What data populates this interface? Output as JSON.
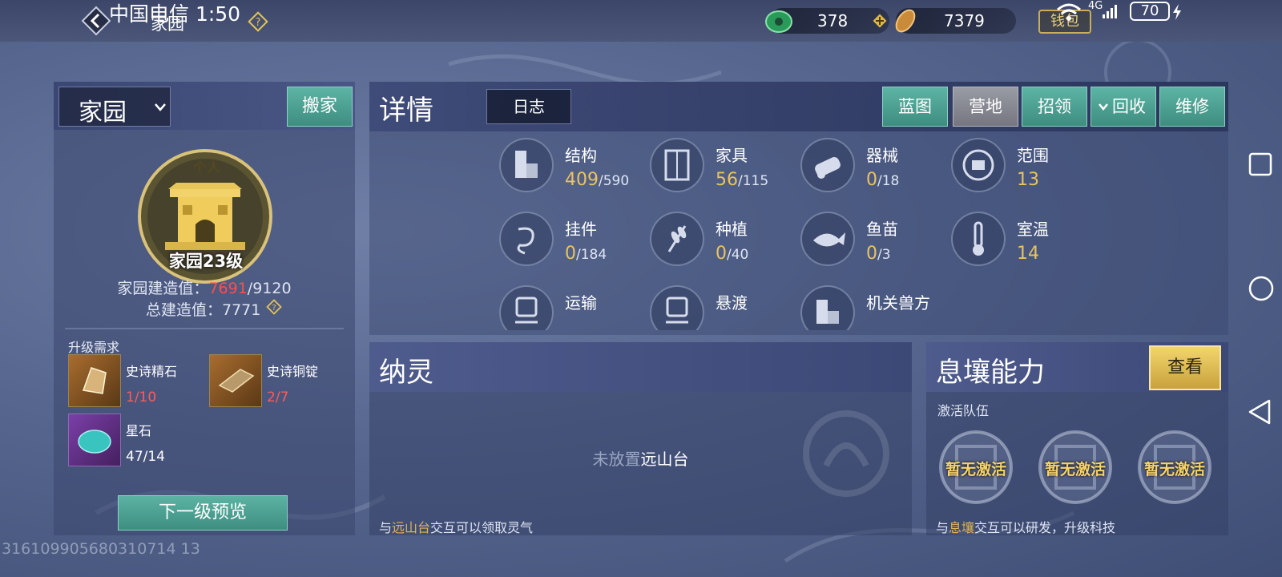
{
  "status": {
    "carrier_time": "中国电信 1:50",
    "signal": "4G",
    "battery": "70"
  },
  "topbar": {
    "page_label": "家园",
    "currency_jade": "378",
    "currency_coin": "7379",
    "wallet_label": "钱包"
  },
  "left": {
    "dropdown_title": "家园",
    "move_label": "搬家",
    "emblem_tag": "个人",
    "emblem_level": "家园23级",
    "build_label": "家园建造值：",
    "build_current": "7691",
    "build_max": "/9120",
    "total_build": "总建造值：7771",
    "req_title": "升级需求",
    "materials": [
      {
        "name": "史诗精石",
        "count": "1/10"
      },
      {
        "name": "史诗铜锭",
        "count": "2/7"
      },
      {
        "name": "星石",
        "count": "47/14"
      }
    ],
    "next_label": "下一级预览"
  },
  "details": {
    "title": "详情",
    "log_tab": "日志",
    "tabs": [
      "蓝图",
      "营地",
      "招领",
      "回收",
      "维修"
    ],
    "active_tab": "营地",
    "stats": [
      {
        "label": "结构",
        "value": "409",
        "max": "/590",
        "icon": "structure-icon"
      },
      {
        "label": "家具",
        "value": "56",
        "max": "/115",
        "icon": "furniture-icon"
      },
      {
        "label": "器械",
        "value": "0",
        "max": "/18",
        "icon": "machinery-icon"
      },
      {
        "label": "范围",
        "value": "13",
        "max": "",
        "icon": "range-icon"
      },
      {
        "label": "挂件",
        "value": "0",
        "max": "/184",
        "icon": "pendant-icon"
      },
      {
        "label": "种植",
        "value": "0",
        "max": "/40",
        "icon": "planting-icon"
      },
      {
        "label": "鱼苗",
        "value": "0",
        "max": "/3",
        "icon": "fish-icon"
      },
      {
        "label": "室温",
        "value": "14",
        "max": "",
        "icon": "thermometer-icon"
      },
      {
        "label": "运输",
        "value": "",
        "max": "",
        "icon": "transport-icon"
      },
      {
        "label": "悬渡",
        "value": "",
        "max": "",
        "icon": "suspension-icon"
      },
      {
        "label": "机关兽方",
        "value": "",
        "max": "",
        "icon": "mech-beast-icon"
      }
    ]
  },
  "soul": {
    "title": "纳灵",
    "empty_dim": "未放置",
    "empty_bright": "远山台",
    "tip_pre": "与",
    "tip_hl": "远山台",
    "tip_post": "交互可以领取灵气"
  },
  "ability": {
    "title": "息壤能力",
    "view_label": "查看",
    "sub": "激活队伍",
    "slots": [
      "暂无激活",
      "暂无激活",
      "暂无激活"
    ],
    "tip_pre": "与",
    "tip_hl": "息壤",
    "tip_post": "交互可以研发，升级科技"
  },
  "uid": "316109905680310714 13",
  "colors": {
    "teal": "#4fa596",
    "gold": "#e9c35f",
    "red": "#ff4c4c",
    "panel": "#3b4773"
  }
}
